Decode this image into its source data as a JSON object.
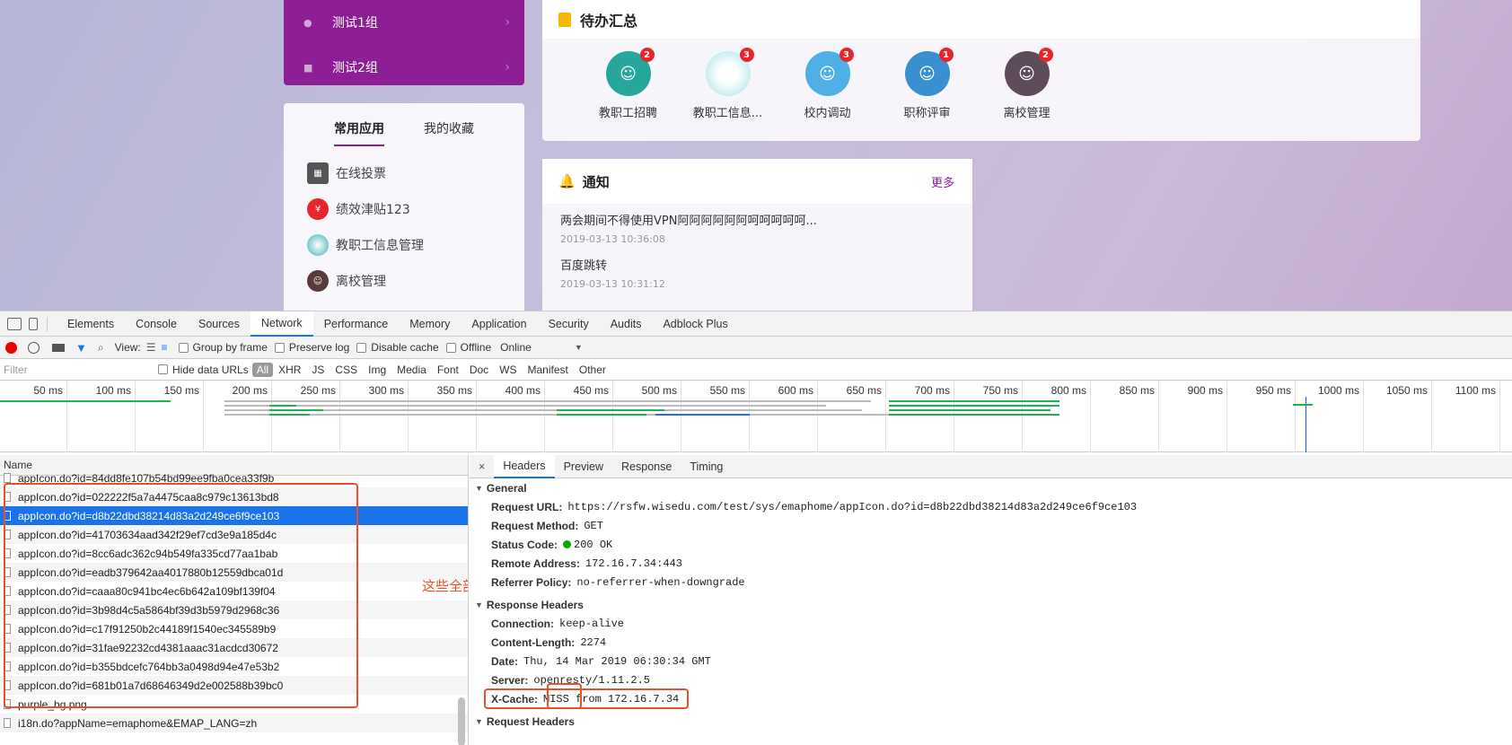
{
  "groups": {
    "items": [
      {
        "label": "测试1组"
      },
      {
        "label": "测试2组"
      }
    ]
  },
  "apps": {
    "tabs": [
      "常用应用",
      "我的收藏"
    ],
    "items": [
      {
        "label": "在线投票",
        "icon": "qr-icon",
        "color": "#555555"
      },
      {
        "label": "绩效津贴123",
        "icon": "money-icon",
        "color": "#e5262c"
      },
      {
        "label": "教职工信息管理",
        "icon": "globe-icon",
        "color": "#3bb3b6"
      },
      {
        "label": "离校管理",
        "icon": "person-icon",
        "color": "#5a3b3b"
      }
    ]
  },
  "todo": {
    "title": "待办汇总",
    "items": [
      {
        "label": "教职工招聘",
        "badge": "2",
        "color": "#27a79c"
      },
      {
        "label": "教职工信息...",
        "badge": "3",
        "color": "#9fe0e4"
      },
      {
        "label": "校内调动",
        "badge": "3",
        "color": "#4fb0e6"
      },
      {
        "label": "职称评审",
        "badge": "1",
        "color": "#3a8fd0"
      },
      {
        "label": "离校管理",
        "badge": "2",
        "color": "#5f4c5a"
      }
    ]
  },
  "notice": {
    "title": "通知",
    "more": "更多",
    "items": [
      {
        "title": "两会期间不得使用VPN阿阿阿阿阿阿呵呵呵呵呵...",
        "date": "2019-03-13 10:36:08"
      },
      {
        "title": "百度跳转",
        "date": "2019-03-13 10:31:12"
      }
    ]
  },
  "devtools": {
    "tabs": [
      "Elements",
      "Console",
      "Sources",
      "Network",
      "Performance",
      "Memory",
      "Application",
      "Security",
      "Audits",
      "Adblock Plus"
    ],
    "toolbar": {
      "view": "View:",
      "group_by_frame": "Group by frame",
      "preserve_log": "Preserve log",
      "disable_cache": "Disable cache",
      "offline": "Offline",
      "throttle": "Online"
    },
    "filter": {
      "placeholder": "Filter",
      "hide_data_urls": "Hide data URLs",
      "types": [
        "All",
        "XHR",
        "JS",
        "CSS",
        "Img",
        "Media",
        "Font",
        "Doc",
        "WS",
        "Manifest",
        "Other"
      ]
    },
    "timeline_ticks": [
      "50 ms",
      "100 ms",
      "150 ms",
      "200 ms",
      "250 ms",
      "300 ms",
      "350 ms",
      "400 ms",
      "450 ms",
      "500 ms",
      "550 ms",
      "600 ms",
      "650 ms",
      "700 ms",
      "750 ms",
      "800 ms",
      "850 ms",
      "900 ms",
      "950 ms",
      "1000 ms",
      "1050 ms",
      "1100 ms"
    ],
    "name_header": "Name",
    "requests": [
      "appIcon.do?id=84dd8fe107b54bd99ee9fba0cea33f9b",
      "appIcon.do?id=022222f5a7a4475caa8c979c13613bd8",
      "appIcon.do?id=d8b22dbd38214d83a2d249ce6f9ce103",
      "appIcon.do?id=41703634aad342f29ef7cd3e9a185d4c",
      "appIcon.do?id=8cc6adc362c94b549fa335cd77aa1bab",
      "appIcon.do?id=eadb379642aa4017880b12559dbca01d",
      "appIcon.do?id=caaa80c941bc4ec6b642a109bf139f04",
      "appIcon.do?id=3b98d4c5a5864bf39d3b5979d2968c36",
      "appIcon.do?id=c17f91250b2c44189f1540ec345589b9",
      "appIcon.do?id=31fae92232cd4381aaac31acdcd30672",
      "appIcon.do?id=b355bdcefc764bb3a0498d94e47e53b2",
      "appIcon.do?id=681b01a7d68646349d2e002588b39bc0",
      "purple_bg.png",
      "i18n.do?appName=emaphome&EMAP_LANG=zh"
    ],
    "selected_index": 2,
    "annotation": "这些全部是MISS",
    "detail_tabs": [
      "Headers",
      "Preview",
      "Response",
      "Timing"
    ],
    "general": {
      "title": "General",
      "rows": [
        {
          "k": "Request URL:",
          "v": "https://rsfw.wisedu.com/test/sys/emaphome/appIcon.do?id=d8b22dbd38214d83a2d249ce6f9ce103"
        },
        {
          "k": "Request Method:",
          "v": "GET"
        },
        {
          "k": "Status Code:",
          "v": "200 OK"
        },
        {
          "k": "Remote Address:",
          "v": "172.16.7.34:443"
        },
        {
          "k": "Referrer Policy:",
          "v": "no-referrer-when-downgrade"
        }
      ]
    },
    "response_headers": {
      "title": "Response Headers",
      "rows": [
        {
          "k": "Connection:",
          "v": "keep-alive"
        },
        {
          "k": "Content-Length:",
          "v": "2274"
        },
        {
          "k": "Date:",
          "v": "Thu, 14 Mar 2019 06:30:34 GMT"
        },
        {
          "k": "Server:",
          "v": "openresty/1.11.2.5"
        },
        {
          "k": "X-Cache:",
          "v": "MISS from 172.16.7.34"
        }
      ]
    },
    "request_headers": {
      "title": "Request Headers"
    }
  }
}
